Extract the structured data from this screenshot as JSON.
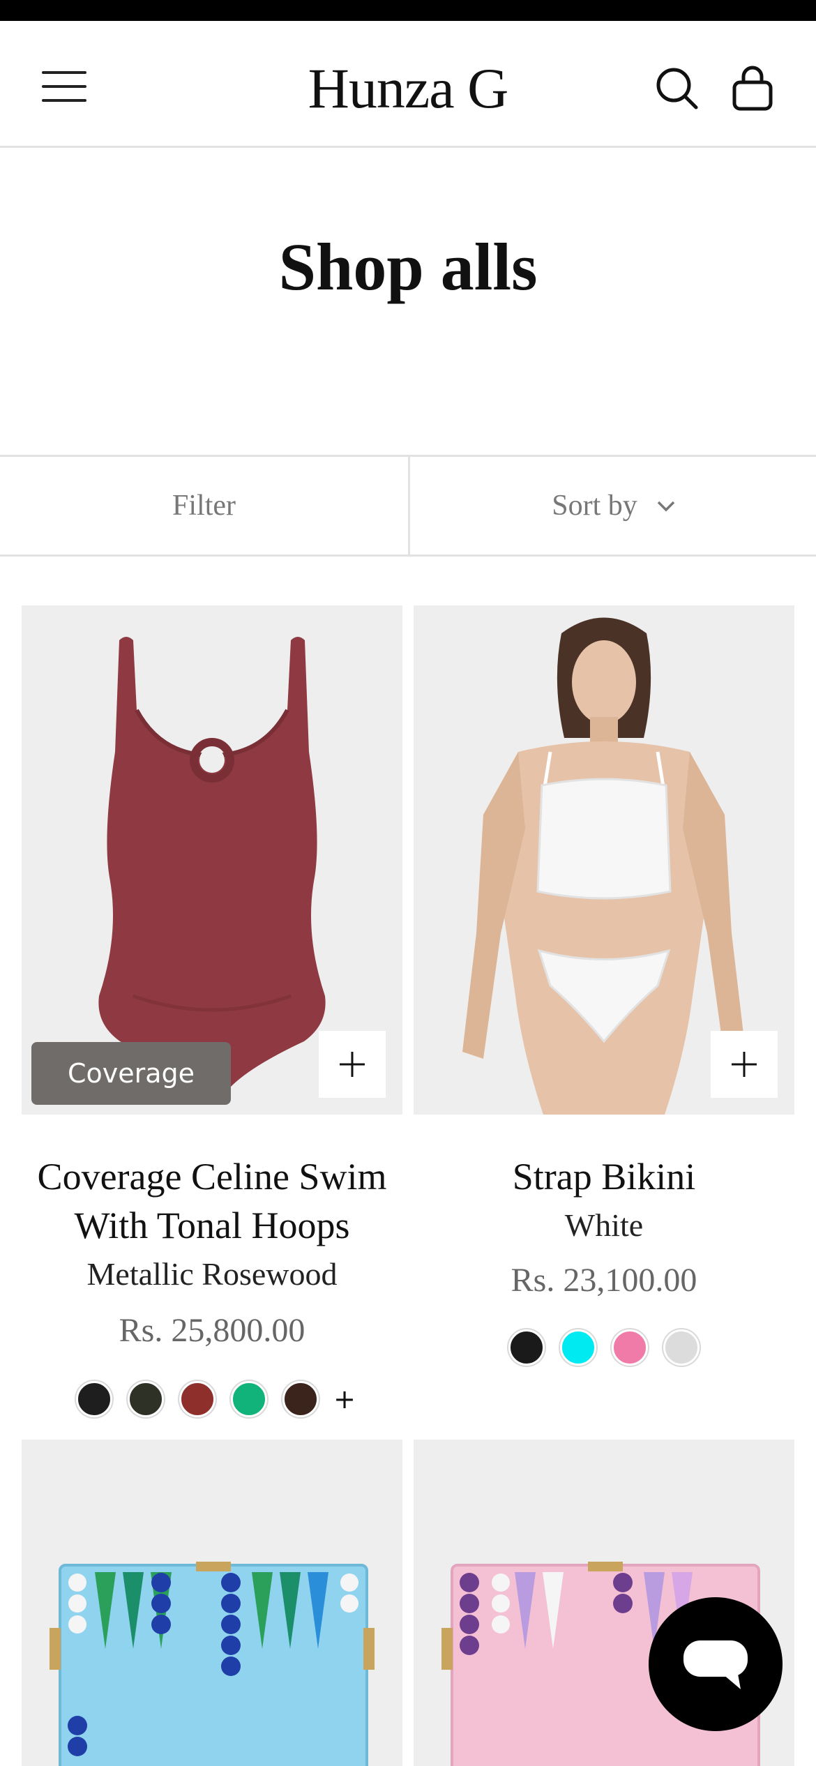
{
  "header": {
    "logo": "Hunza G",
    "menu_icon": "hamburger-menu-icon",
    "search_icon": "search-icon",
    "cart_icon": "shopping-bag-icon"
  },
  "page": {
    "title": "Shop alls"
  },
  "toolbar": {
    "filter_label": "Filter",
    "sort_label": "Sort by",
    "sort_icon": "chevron-down-icon"
  },
  "products": [
    {
      "badge": "Coverage",
      "name_line1": "Coverage Celine Swim",
      "name_line2": "With Tonal Hoops",
      "variant": "Metallic Rosewood",
      "price": "Rs. 25,800.00",
      "swatches": [
        "#1e1e1e",
        "#2e3126",
        "#8f2f2c",
        "#12b37a",
        "#3b241b"
      ],
      "more_swatches": "+",
      "garment_color": "#8f3a42"
    },
    {
      "name_line1": "Strap Bikini",
      "variant": "White",
      "price": "Rs. 23,100.00",
      "swatches": [
        "#1a1a1a",
        "#00eaf2",
        "#f07aa8",
        "#dcdcdc"
      ]
    },
    {
      "board_color": "#8fd3ee"
    },
    {
      "board_color": "#f4c1d4"
    }
  ],
  "chat": {
    "icon": "chat-bubble-icon"
  }
}
